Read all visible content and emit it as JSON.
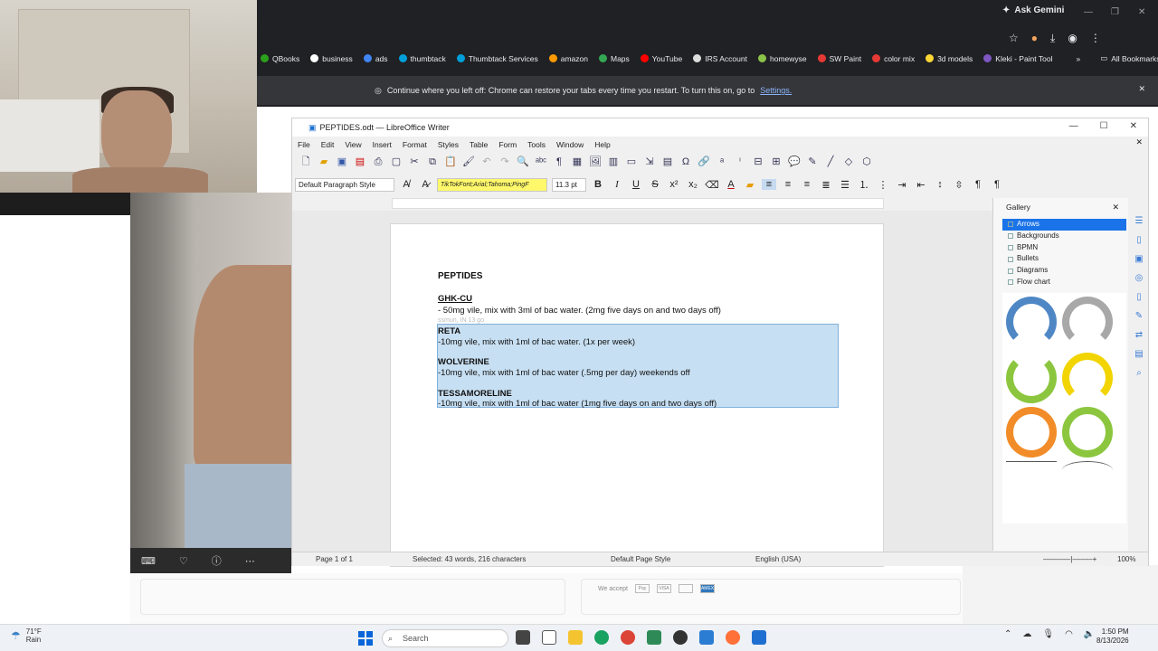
{
  "browser": {
    "ask_gemini": "Ask Gemini",
    "bookmarks": [
      "QBooks",
      "business",
      "ads",
      "thumbtack",
      "Thumbtack Services",
      "amazon",
      "Maps",
      "YouTube",
      "IRS Account",
      "homewyse",
      "SW Paint",
      "color mix",
      "3d models",
      "Kleki - Paint Tool"
    ],
    "all_bookmarks": "All Bookmarks",
    "restore_message": "Continue where you left off: Chrome can restore your tabs every time you restart. To turn this on, go to",
    "restore_link": "Settings."
  },
  "bg_page": {
    "we_accept": "We accept",
    "pay_labels": [
      "Pay",
      "VISA",
      "",
      "AMEX"
    ]
  },
  "writer": {
    "title": "PEPTIDES.odt — LibreOffice Writer",
    "menu": [
      "File",
      "Edit",
      "View",
      "Insert",
      "Format",
      "Styles",
      "Table",
      "Form",
      "Tools",
      "Window",
      "Help"
    ],
    "para_style": "Default Paragraph Style",
    "font_name": "TikTokFont;Arial;Tahoma;PingF",
    "font_size": "11.3 pt",
    "doc": {
      "heading": "PEPTIDES",
      "ghk_title": "GHK-CU",
      "ghk_line": "- 50mg vile, mix with 3ml of bac water. (2mg five days on and two days off)",
      "ghost_text": "ssmun, IN 13 go",
      "reta_title": "RETA",
      "reta_line": "-10mg vile, mix with 1ml of bac water. (1x per week)",
      "wolverine_title": "WOLVERINE",
      "wolverine_line": "-10mg vile, mix with 1ml of bac water (.5mg per day) weekends off",
      "tesa_title": "TESSAMORELINE",
      "tesa_line": "-10mg vile, mix with 1ml of bac water (1mg five days on and two days off)"
    },
    "status": {
      "page": "Page 1 of 1",
      "selected": "Selected: 43 words, 216 characters",
      "page_style": "Default Page Style",
      "language": "English (USA)",
      "zoom": "100%"
    },
    "gallery": {
      "title": "Gallery",
      "items": [
        "Arrows",
        "Backgrounds",
        "BPMN",
        "Bullets",
        "Diagrams",
        "Flow chart"
      ],
      "active": "Arrows"
    }
  },
  "taskbar": {
    "weather_temp": "71°F",
    "weather_desc": "Rain",
    "search": "Search",
    "time": "1:50 PM",
    "date": "8/13/2026"
  }
}
